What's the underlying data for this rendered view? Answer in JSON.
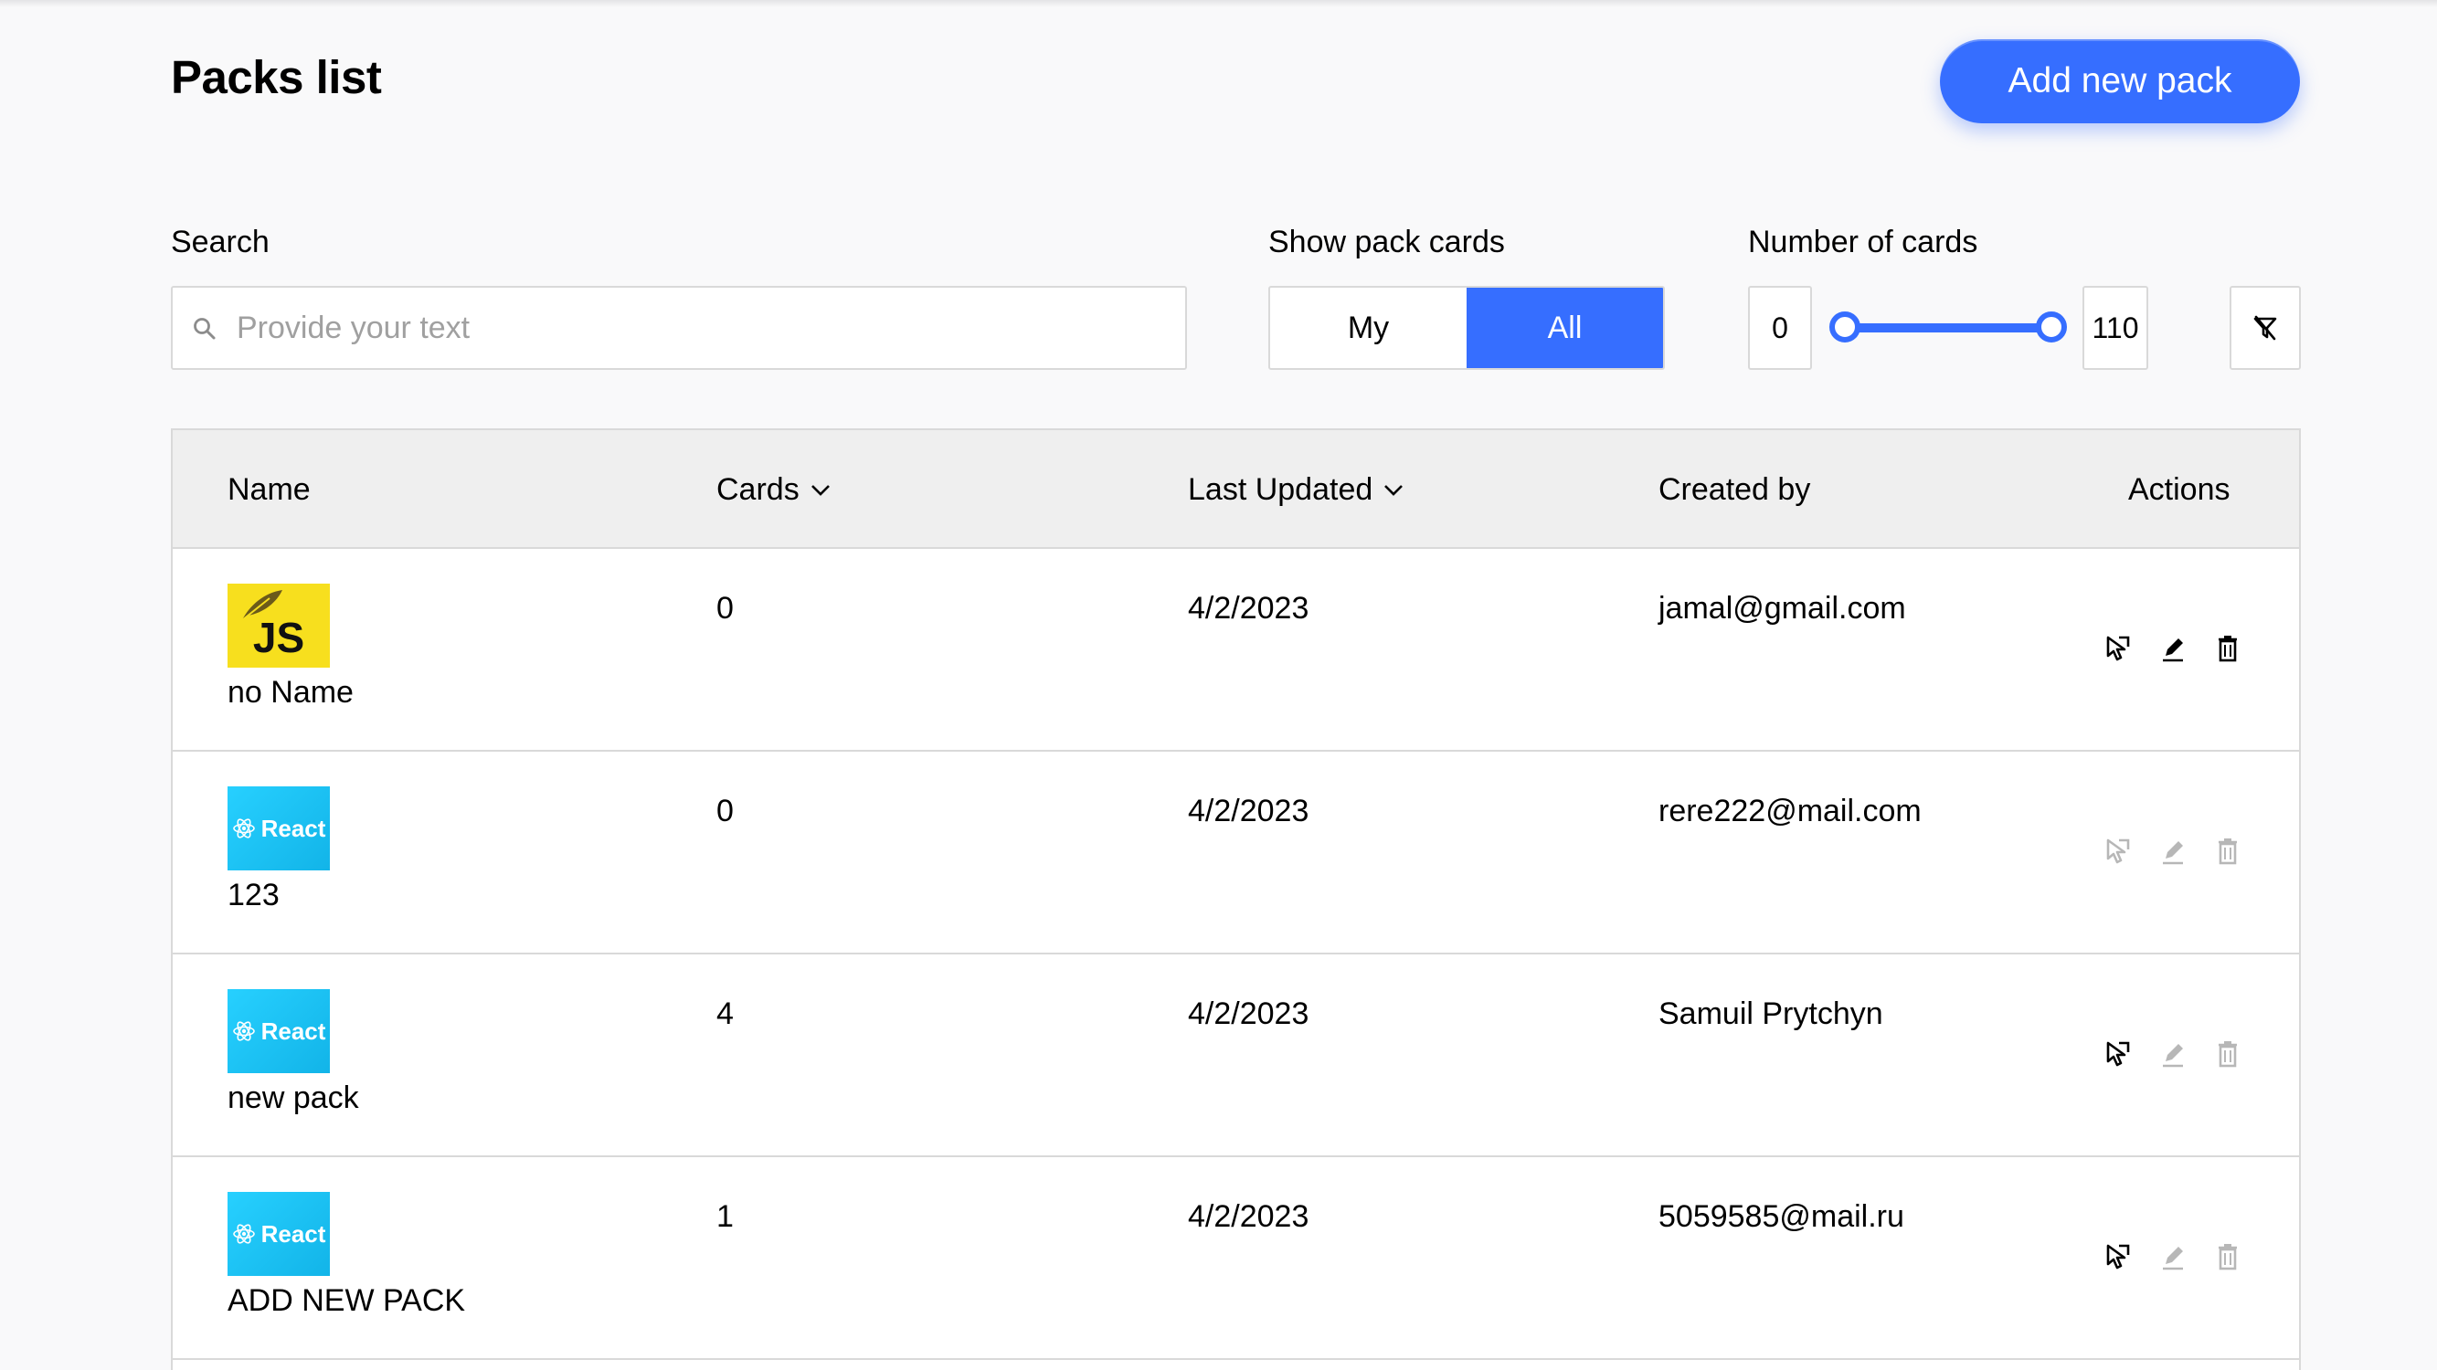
{
  "header": {
    "title": "Packs list",
    "add_button": "Add new pack"
  },
  "filters": {
    "search_label": "Search",
    "search_placeholder": "Provide your text",
    "search_value": "",
    "show_label": "Show pack cards",
    "show_options": [
      "My",
      "All"
    ],
    "show_selected": "All",
    "cards_label": "Number of cards",
    "min": "0",
    "max": "110"
  },
  "table": {
    "columns": {
      "name": "Name",
      "cards": "Cards",
      "updated": "Last Updated",
      "created": "Created by",
      "actions": "Actions"
    },
    "rows": [
      {
        "cover": "JS",
        "cover_type": "js",
        "name": "no Name",
        "cards": "0",
        "updated": "4/2/2023",
        "created_by": "jamal@gmail.com",
        "learn_enabled": true,
        "edit_enabled": true,
        "delete_enabled": true
      },
      {
        "cover": "React",
        "cover_type": "react",
        "name": "123",
        "cards": "0",
        "updated": "4/2/2023",
        "created_by": "rere222@mail.com",
        "learn_enabled": false,
        "edit_enabled": false,
        "delete_enabled": false
      },
      {
        "cover": "React",
        "cover_type": "react",
        "name": "new pack",
        "cards": "4",
        "updated": "4/2/2023",
        "created_by": "Samuil Prytchyn",
        "learn_enabled": true,
        "edit_enabled": false,
        "delete_enabled": false
      },
      {
        "cover": "React",
        "cover_type": "react",
        "name": "ADD NEW PACK",
        "cards": "1",
        "updated": "4/2/2023",
        "created_by": "5059585@mail.ru",
        "learn_enabled": true,
        "edit_enabled": false,
        "delete_enabled": false
      }
    ]
  },
  "colors": {
    "accent": "#366eff",
    "header_bg": "#efefef",
    "page_bg": "#f9f9fa"
  },
  "icons": {
    "search": "search-icon",
    "filter_reset": "filter-off-icon",
    "sort": "chevron-down-icon",
    "learn": "learn-icon",
    "edit": "pencil-icon",
    "delete": "trash-icon"
  }
}
